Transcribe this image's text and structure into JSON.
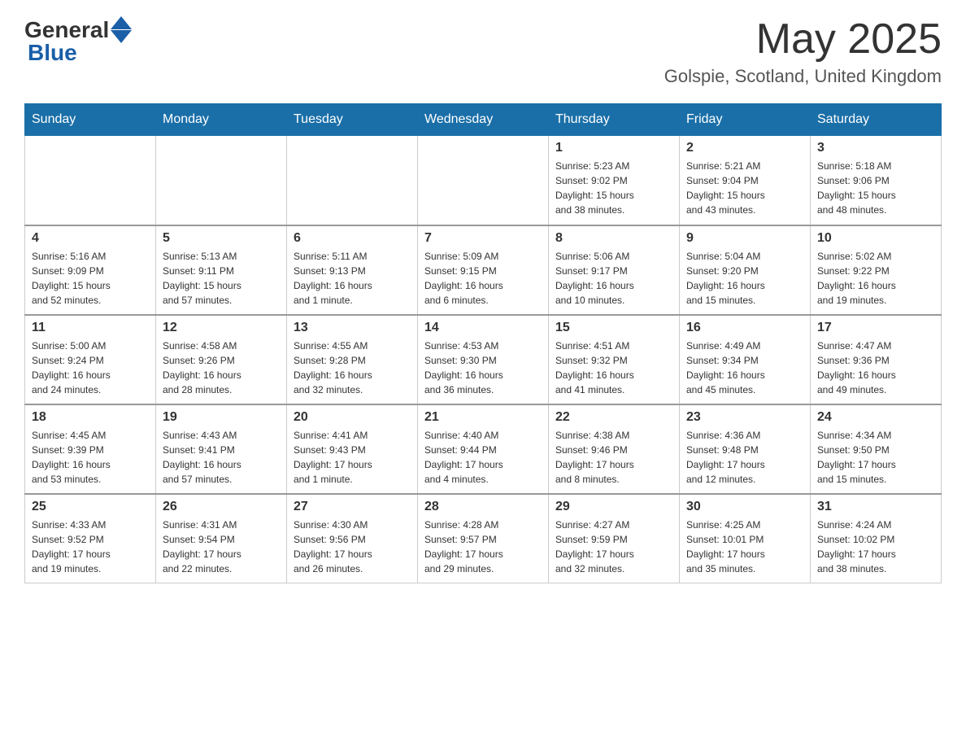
{
  "header": {
    "logo": {
      "general": "General",
      "blue": "Blue"
    },
    "title": "May 2025",
    "location": "Golspie, Scotland, United Kingdom"
  },
  "days_of_week": [
    "Sunday",
    "Monday",
    "Tuesday",
    "Wednesday",
    "Thursday",
    "Friday",
    "Saturday"
  ],
  "weeks": [
    [
      {
        "day": "",
        "info": ""
      },
      {
        "day": "",
        "info": ""
      },
      {
        "day": "",
        "info": ""
      },
      {
        "day": "",
        "info": ""
      },
      {
        "day": "1",
        "info": "Sunrise: 5:23 AM\nSunset: 9:02 PM\nDaylight: 15 hours\nand 38 minutes."
      },
      {
        "day": "2",
        "info": "Sunrise: 5:21 AM\nSunset: 9:04 PM\nDaylight: 15 hours\nand 43 minutes."
      },
      {
        "day": "3",
        "info": "Sunrise: 5:18 AM\nSunset: 9:06 PM\nDaylight: 15 hours\nand 48 minutes."
      }
    ],
    [
      {
        "day": "4",
        "info": "Sunrise: 5:16 AM\nSunset: 9:09 PM\nDaylight: 15 hours\nand 52 minutes."
      },
      {
        "day": "5",
        "info": "Sunrise: 5:13 AM\nSunset: 9:11 PM\nDaylight: 15 hours\nand 57 minutes."
      },
      {
        "day": "6",
        "info": "Sunrise: 5:11 AM\nSunset: 9:13 PM\nDaylight: 16 hours\nand 1 minute."
      },
      {
        "day": "7",
        "info": "Sunrise: 5:09 AM\nSunset: 9:15 PM\nDaylight: 16 hours\nand 6 minutes."
      },
      {
        "day": "8",
        "info": "Sunrise: 5:06 AM\nSunset: 9:17 PM\nDaylight: 16 hours\nand 10 minutes."
      },
      {
        "day": "9",
        "info": "Sunrise: 5:04 AM\nSunset: 9:20 PM\nDaylight: 16 hours\nand 15 minutes."
      },
      {
        "day": "10",
        "info": "Sunrise: 5:02 AM\nSunset: 9:22 PM\nDaylight: 16 hours\nand 19 minutes."
      }
    ],
    [
      {
        "day": "11",
        "info": "Sunrise: 5:00 AM\nSunset: 9:24 PM\nDaylight: 16 hours\nand 24 minutes."
      },
      {
        "day": "12",
        "info": "Sunrise: 4:58 AM\nSunset: 9:26 PM\nDaylight: 16 hours\nand 28 minutes."
      },
      {
        "day": "13",
        "info": "Sunrise: 4:55 AM\nSunset: 9:28 PM\nDaylight: 16 hours\nand 32 minutes."
      },
      {
        "day": "14",
        "info": "Sunrise: 4:53 AM\nSunset: 9:30 PM\nDaylight: 16 hours\nand 36 minutes."
      },
      {
        "day": "15",
        "info": "Sunrise: 4:51 AM\nSunset: 9:32 PM\nDaylight: 16 hours\nand 41 minutes."
      },
      {
        "day": "16",
        "info": "Sunrise: 4:49 AM\nSunset: 9:34 PM\nDaylight: 16 hours\nand 45 minutes."
      },
      {
        "day": "17",
        "info": "Sunrise: 4:47 AM\nSunset: 9:36 PM\nDaylight: 16 hours\nand 49 minutes."
      }
    ],
    [
      {
        "day": "18",
        "info": "Sunrise: 4:45 AM\nSunset: 9:39 PM\nDaylight: 16 hours\nand 53 minutes."
      },
      {
        "day": "19",
        "info": "Sunrise: 4:43 AM\nSunset: 9:41 PM\nDaylight: 16 hours\nand 57 minutes."
      },
      {
        "day": "20",
        "info": "Sunrise: 4:41 AM\nSunset: 9:43 PM\nDaylight: 17 hours\nand 1 minute."
      },
      {
        "day": "21",
        "info": "Sunrise: 4:40 AM\nSunset: 9:44 PM\nDaylight: 17 hours\nand 4 minutes."
      },
      {
        "day": "22",
        "info": "Sunrise: 4:38 AM\nSunset: 9:46 PM\nDaylight: 17 hours\nand 8 minutes."
      },
      {
        "day": "23",
        "info": "Sunrise: 4:36 AM\nSunset: 9:48 PM\nDaylight: 17 hours\nand 12 minutes."
      },
      {
        "day": "24",
        "info": "Sunrise: 4:34 AM\nSunset: 9:50 PM\nDaylight: 17 hours\nand 15 minutes."
      }
    ],
    [
      {
        "day": "25",
        "info": "Sunrise: 4:33 AM\nSunset: 9:52 PM\nDaylight: 17 hours\nand 19 minutes."
      },
      {
        "day": "26",
        "info": "Sunrise: 4:31 AM\nSunset: 9:54 PM\nDaylight: 17 hours\nand 22 minutes."
      },
      {
        "day": "27",
        "info": "Sunrise: 4:30 AM\nSunset: 9:56 PM\nDaylight: 17 hours\nand 26 minutes."
      },
      {
        "day": "28",
        "info": "Sunrise: 4:28 AM\nSunset: 9:57 PM\nDaylight: 17 hours\nand 29 minutes."
      },
      {
        "day": "29",
        "info": "Sunrise: 4:27 AM\nSunset: 9:59 PM\nDaylight: 17 hours\nand 32 minutes."
      },
      {
        "day": "30",
        "info": "Sunrise: 4:25 AM\nSunset: 10:01 PM\nDaylight: 17 hours\nand 35 minutes."
      },
      {
        "day": "31",
        "info": "Sunrise: 4:24 AM\nSunset: 10:02 PM\nDaylight: 17 hours\nand 38 minutes."
      }
    ]
  ]
}
